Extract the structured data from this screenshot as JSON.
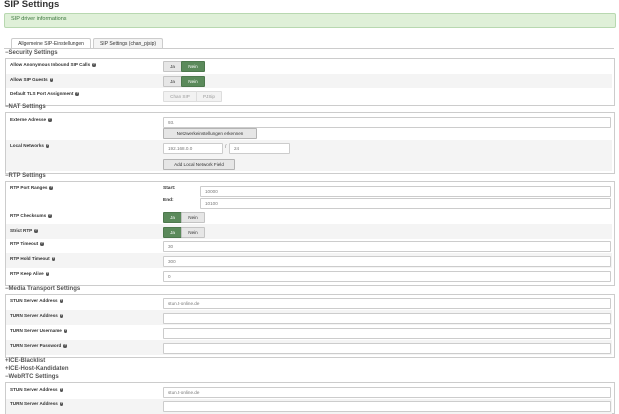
{
  "page": {
    "title": "SIP Settings"
  },
  "alert": {
    "text": "SIP driver informations"
  },
  "tabs": [
    {
      "label": "Allgemeine SIP-Einstellungen",
      "active": true
    },
    {
      "label": "SIP Settings (chan_pjsip)",
      "active": false
    }
  ],
  "toggle": {
    "yes": "Ja",
    "no": "Nein"
  },
  "security": {
    "heading": "Security Settings",
    "allow_anonymous_label": "Allow Anonymous Inbound SIP Calls",
    "allow_anonymous_value": "Nein",
    "allow_guests_label": "Allow SIP Guests",
    "allow_guests_value": "Nein",
    "tls_port_label": "Default TLS Port Assignment",
    "tls_options": [
      "Chan SIP",
      "PJSip"
    ]
  },
  "nat": {
    "heading": "NAT Settings",
    "external_label": "Externe Adresse",
    "external_value": "93.",
    "detect_button": "Netzwerkeinstellungen erkennen",
    "local_networks_label": "Local Networks",
    "local_network_ip": "192.168.0.0",
    "separator": "/",
    "local_network_mask": "24",
    "add_local_button": "Add Local Network Field"
  },
  "rtp": {
    "heading": "RTP Settings",
    "port_ranges_label": "RTP Port Ranges",
    "start_label": "Start:",
    "start_value": "10000",
    "end_label": "End:",
    "end_value": "10100",
    "checksums_label": "RTP Checksums",
    "checksums_value": "Ja",
    "strict_label": "Strict RTP",
    "strict_value": "Ja",
    "timeout_label": "RTP Timeout",
    "timeout_value": "30",
    "hold_timeout_label": "RTP Hold Timeout",
    "hold_timeout_value": "300",
    "keep_alive_label": "RTP Keep Alive",
    "keep_alive_value": "0"
  },
  "media": {
    "heading": "Media Transport Settings",
    "stun_label": "STUN Server Address",
    "stun_value": "stun.t-online.de",
    "turn_label": "TURN Server Address",
    "turn_value": "",
    "turn_user_label": "TURN Server Username",
    "turn_user_value": "",
    "turn_pass_label": "TURN Server Password",
    "turn_pass_value": ""
  },
  "ice_blacklist": {
    "heading": "ICE-Blacklist"
  },
  "ice_host": {
    "heading": "ICE-Host-Kandidaten"
  },
  "webrtc": {
    "heading": "WebRTC Settings",
    "stun_label": "STUN Server Address",
    "stun_value": "stun.t-online.de",
    "turn_label": "TURN Server Address"
  },
  "colors": {
    "active_toggle": "#5b8a5b",
    "alert_bg": "#dff0d8",
    "row_bg": "#f4f4f4"
  },
  "icons": {
    "help": "question-circle-icon",
    "collapse": "minus-icon",
    "expand": "plus-icon"
  }
}
